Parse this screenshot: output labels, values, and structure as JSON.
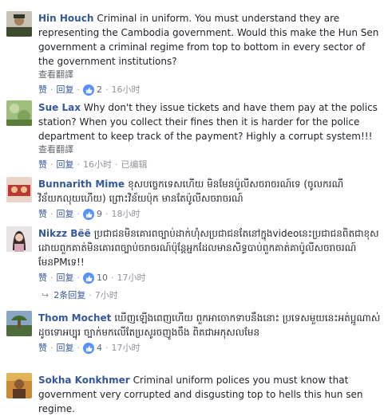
{
  "comments": [
    {
      "author": "Hin Houch",
      "text": "Criminal in uniform. You must understand they are representing the Cambodia government. Would this make the Hun Sen government a criminal regime from top to bottom in every sector of the government institutions?",
      "translate": "查看翻譯",
      "like": "赞",
      "reply": "回复",
      "likes": "2",
      "time": "16小时"
    },
    {
      "author": "Sue Lax",
      "text": "Why don't they issue tickets and have them pay at the polics station? When you collect their fines then it is harder for the police department to keep track of the payment? Highly a corrupt system!!!",
      "translate": "查看翻譯",
      "like": "赞",
      "reply": "回复",
      "time": "16小时",
      "edited": "已编辑"
    },
    {
      "author": "Bunnarith Mime",
      "text": "ខុសបច្ចេកទេសហើយ មិនមែនប៉ូលីសចរាចរណ៍ទេ (ចូលករណីវិន័យកលុយហើយ) ព្រោះវិន័យប៉ុក មានតែប៉ូលីសចរាចរណ៍",
      "like": "赞",
      "reply": "回复",
      "likes": "9",
      "time": "18小时"
    },
    {
      "author": "Nikzz Bëë",
      "text": "ប្រជាជនមិនគោរពច្បាប់ដាក់ហុំសប្រជាជនតែនៅក្នុងvideoនេះប្រជាជនពិតជាខុសដោយពួកគាត់មិនគោរពច្បាប់ចរាចរណ៍ប៉ុន្តែអ្នកដែលមានសិទ្ធបាប់ពួកគាត់គាប៉ូលីសចរាចរណ៍ មែនPMទេ!!",
      "like": "赞",
      "reply": "回复",
      "likes": "10",
      "time": "17小时",
      "replies": "2条回复",
      "replies_time": "7小时"
    },
    {
      "author": "Thom Mochet",
      "text": "ឃើញឡើងពេញហើយ ពួកអាចោកទាបនឹងនោះ ប្រទេសមួយនេះអត់ប្អូណាស់ ដូចទោអប្បុរ ច្បាក់មកលើតែប្រសូរចញូងចឹង ពិតជាអកុសលមែន",
      "like": "赞",
      "reply": "回复",
      "likes": "4",
      "time": "17小时"
    },
    {
      "author": "Sokha Konkhmer",
      "text": "Criminal uniform polices you must know that government very corrupted and disgusting top to hells this hun sen regime."
    }
  ],
  "colors": {
    "link": "#365899",
    "meta": "#90949c",
    "like_badge": "#5890ff"
  }
}
